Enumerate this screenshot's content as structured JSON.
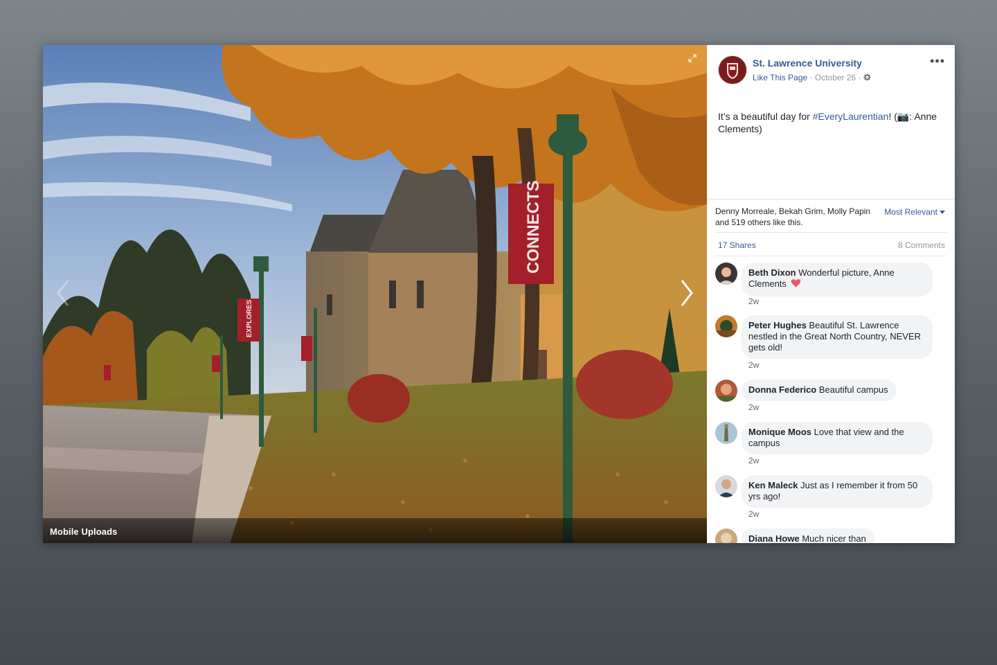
{
  "photo": {
    "caption": "Mobile Uploads",
    "banner_text": "CONNECTS",
    "banner_text_2": "EXPLORES"
  },
  "post": {
    "page_name": "St. Lawrence University",
    "like_page": "Like This Page",
    "date": "October 26",
    "text_before": "It’s a beautiful day for ",
    "hashtag": "#EveryLaurentian",
    "text_after": "! (📷: Anne Clements)",
    "likes_summary": "Denny Morreale, Bekah Grim, Molly Papin and 519 others like this.",
    "sort_label": "Most Relevant",
    "shares": "17 Shares",
    "comments_count": "8 Comments"
  },
  "comments": [
    {
      "author": "Beth Dixon",
      "text": "Wonderful picture, Anne Clements",
      "time": "2w",
      "avatar_color": "#6b4a3a",
      "heart": true
    },
    {
      "author": "Peter Hughes",
      "text": "Beautiful St. Lawrence nestled in the Great North Country, NEVER gets old!",
      "time": "2w",
      "avatar_color": "#c27a2a"
    },
    {
      "author": "Donna Federico",
      "text": "Beautiful campus",
      "time": "2w",
      "avatar_color": "#b5553a"
    },
    {
      "author": "Monique Moos",
      "text": "Love that view and the campus",
      "time": "2w",
      "avatar_color": "#7fa2b5"
    },
    {
      "author": "Ken Maleck",
      "text": "Just as I remember it from 50 yrs ago!",
      "time": "2w",
      "avatar_color": "#556270"
    },
    {
      "author": "Diana Howe",
      "text": "Much nicer than",
      "time": "",
      "avatar_color": "#c9a878"
    }
  ],
  "colors": {
    "link": "#365899",
    "heart": "#f25268",
    "bubble": "#f2f3f5"
  }
}
